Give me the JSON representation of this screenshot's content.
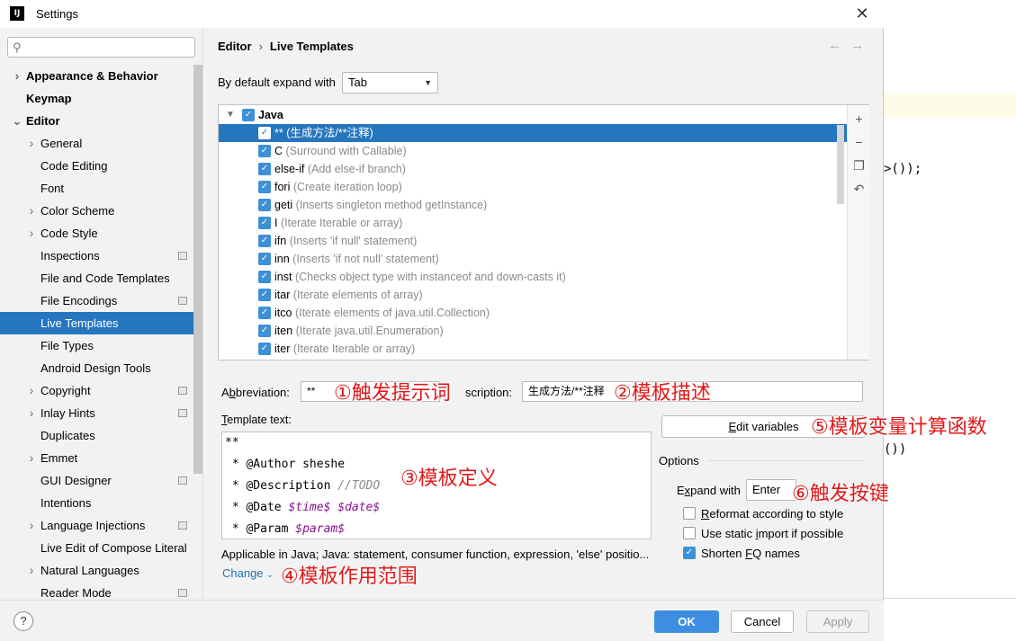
{
  "window": {
    "title": "Settings",
    "app_icon": "intellij-icon"
  },
  "search": {
    "placeholder": ""
  },
  "sidebar": {
    "items": [
      {
        "label": "Appearance & Behavior",
        "level": 0,
        "arrow": "right",
        "bold": true
      },
      {
        "label": "Keymap",
        "level": 0,
        "arrow": "",
        "bold": true
      },
      {
        "label": "Editor",
        "level": 0,
        "arrow": "down",
        "bold": true
      },
      {
        "label": "General",
        "level": 1,
        "arrow": "right"
      },
      {
        "label": "Code Editing",
        "level": 1,
        "arrow": ""
      },
      {
        "label": "Font",
        "level": 1,
        "arrow": ""
      },
      {
        "label": "Color Scheme",
        "level": 1,
        "arrow": "right"
      },
      {
        "label": "Code Style",
        "level": 1,
        "arrow": "right"
      },
      {
        "label": "Inspections",
        "level": 1,
        "arrow": "",
        "project": true
      },
      {
        "label": "File and Code Templates",
        "level": 1,
        "arrow": ""
      },
      {
        "label": "File Encodings",
        "level": 1,
        "arrow": "",
        "project": true
      },
      {
        "label": "Live Templates",
        "level": 1,
        "arrow": "",
        "selected": true
      },
      {
        "label": "File Types",
        "level": 1,
        "arrow": ""
      },
      {
        "label": "Android Design Tools",
        "level": 1,
        "arrow": ""
      },
      {
        "label": "Copyright",
        "level": 1,
        "arrow": "right",
        "project": true
      },
      {
        "label": "Inlay Hints",
        "level": 1,
        "arrow": "right",
        "project": true
      },
      {
        "label": "Duplicates",
        "level": 1,
        "arrow": ""
      },
      {
        "label": "Emmet",
        "level": 1,
        "arrow": "right"
      },
      {
        "label": "GUI Designer",
        "level": 1,
        "arrow": "",
        "project": true
      },
      {
        "label": "Intentions",
        "level": 1,
        "arrow": ""
      },
      {
        "label": "Language Injections",
        "level": 1,
        "arrow": "right",
        "project": true
      },
      {
        "label": "Live Edit of Compose Literal",
        "level": 1,
        "arrow": ""
      },
      {
        "label": "Natural Languages",
        "level": 1,
        "arrow": "right"
      },
      {
        "label": "Reader Mode",
        "level": 1,
        "arrow": "",
        "project": true
      }
    ]
  },
  "breadcrumb": {
    "parent": "Editor",
    "current": "Live Templates"
  },
  "expand": {
    "label": "By default expand with",
    "value": "Tab"
  },
  "templates": {
    "group": "Java",
    "rows": [
      {
        "abbr": "**",
        "desc": "(生成方法/**注释)",
        "selected": true
      },
      {
        "abbr": "C",
        "desc": "(Surround with Callable)"
      },
      {
        "abbr": "else-if",
        "desc": "(Add else-if branch)"
      },
      {
        "abbr": "fori",
        "desc": "(Create iteration loop)"
      },
      {
        "abbr": "geti",
        "desc": "(Inserts singleton method getInstance)"
      },
      {
        "abbr": "I",
        "desc": "(Iterate Iterable or array)"
      },
      {
        "abbr": "ifn",
        "desc": "(Inserts 'if null' statement)"
      },
      {
        "abbr": "inn",
        "desc": "(Inserts 'if not null' statement)"
      },
      {
        "abbr": "inst",
        "desc": "(Checks object type with instanceof and down-casts it)"
      },
      {
        "abbr": "itar",
        "desc": "(Iterate elements of array)"
      },
      {
        "abbr": "itco",
        "desc": "(Iterate elements of java.util.Collection)"
      },
      {
        "abbr": "iten",
        "desc": "(Iterate java.util.Enumeration)"
      },
      {
        "abbr": "iter",
        "desc": "(Iterate Iterable or array)"
      }
    ]
  },
  "abbreviation": {
    "label_pre": "A",
    "label_u": "b",
    "label_post": "breviation:",
    "value": "**"
  },
  "description": {
    "label": "scription:",
    "value": "生成方法/**注释"
  },
  "template_text": {
    "label_u": "T",
    "label_rest": "emplate text:",
    "lines": [
      {
        "parts": [
          {
            "t": "**",
            "k": ""
          }
        ]
      },
      {
        "parts": [
          {
            "t": " * @Author sheshe",
            "k": ""
          }
        ]
      },
      {
        "parts": [
          {
            "t": " * @Description ",
            "k": ""
          },
          {
            "t": "//TODO",
            "k": "c"
          }
        ]
      },
      {
        "parts": [
          {
            "t": " * @Date ",
            "k": ""
          },
          {
            "t": "$time$",
            "k": "v"
          },
          {
            "t": " ",
            "k": ""
          },
          {
            "t": "$date$",
            "k": "v"
          }
        ]
      },
      {
        "parts": [
          {
            "t": " * @Param ",
            "k": ""
          },
          {
            "t": "$param$",
            "k": "v"
          }
        ]
      }
    ]
  },
  "applicable": {
    "text": "Applicable in Java; Java: statement, consumer function, expression, 'else' positio...",
    "change_label": "Change"
  },
  "edit_variables": {
    "pre": "",
    "u": "E",
    "post": "dit variables"
  },
  "options": {
    "title": "Options",
    "expand_label_pre": "E",
    "expand_label_u": "x",
    "expand_label_post": "pand with",
    "expand_value": "Enter",
    "reformat": {
      "pre": "",
      "u": "R",
      "post": "eformat according to style",
      "checked": false
    },
    "static_import": {
      "pre": "Use static ",
      "u": "i",
      "post": "mport if possible",
      "checked": false
    },
    "shorten": {
      "pre": "Shorten ",
      "u": "F",
      "post": "Q names",
      "checked": true
    }
  },
  "annotations": {
    "a1": "①触发提示词",
    "a2": "②模板描述",
    "a3": "③模板定义",
    "a4": "④模板作用范围",
    "a5": "⑤模板变量计算函数",
    "a6": "⑥触发按键"
  },
  "buttons": {
    "ok": "OK",
    "cancel": "Cancel",
    "apply": "Apply",
    "help": "?"
  },
  "background_code": {
    "line1": ">());",
    "line2": "())"
  },
  "colors": {
    "accent": "#2675bf",
    "primary_button": "#3d8ee0",
    "annotation": "#e01919"
  }
}
